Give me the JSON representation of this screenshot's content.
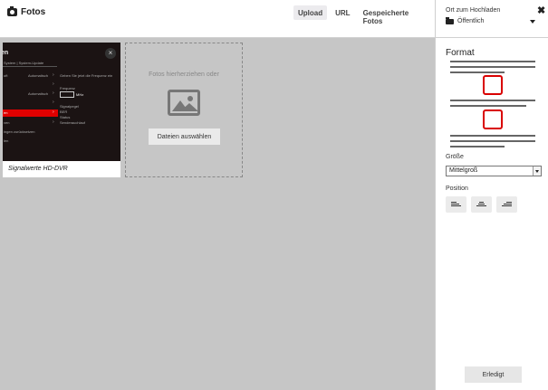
{
  "header": {
    "title": "Fotos",
    "tabs": [
      {
        "label": "Upload",
        "active": true
      },
      {
        "label": "URL",
        "active": false
      },
      {
        "label": "Gespeicherte Fotos",
        "active": false
      }
    ]
  },
  "location": {
    "label": "Ort zum Hochladen",
    "value": "Öffentlich"
  },
  "close_label": "✖",
  "thumbnail": {
    "caption": "Signalwerte HD-DVR",
    "close_label": "×",
    "screen_text": {
      "title": "en",
      "breadcrumb": "System | System-Update",
      "menu": [
        "oft",
        "",
        "",
        "en",
        "ven",
        "ingen zurücksetzen",
        "len"
      ],
      "menu_values": [
        "Automatisch",
        "Automatisch"
      ],
      "instruction": "Geben Sie jetzt die Frequenz ein",
      "freq_label": "Frequenz",
      "freq_unit": "MHz",
      "stats": [
        "Signalpegel",
        "BER",
        "Status",
        "Senderauchlauf"
      ]
    }
  },
  "dropzone": {
    "text": "Fotos hierherziehen oder",
    "button": "Dateien auswählen"
  },
  "panel": {
    "format_title": "Format",
    "size_label": "Größe",
    "size_value": "Mittelgroß",
    "position_label": "Position",
    "done_button": "Erledigt"
  },
  "colors": {
    "accent_red": "#d90000",
    "tv_red": "#e00000",
    "canvas": "#c6c6c6"
  }
}
